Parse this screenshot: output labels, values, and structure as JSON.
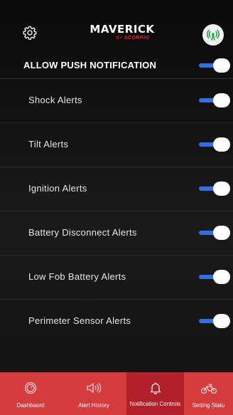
{
  "header": {
    "logo_main": "MAVERICK",
    "logo_by": "BY",
    "logo_brand": "SCORPIO",
    "settings_icon": "gear-icon",
    "signal_icon": "signal-tower-icon"
  },
  "master": {
    "label": "ALLOW PUSH NOTIFICATION",
    "enabled": true
  },
  "alerts": [
    {
      "label": "Shock Alerts",
      "enabled": true
    },
    {
      "label": "Tilt Alerts",
      "enabled": true
    },
    {
      "label": "Ignition Alerts",
      "enabled": true
    },
    {
      "label": "Battery Disconnect Alerts",
      "enabled": true
    },
    {
      "label": "Low Fob Battery Alerts",
      "enabled": true
    },
    {
      "label": "Perimeter Sensor Alerts",
      "enabled": true
    }
  ],
  "tabbar": {
    "tabs": [
      {
        "label": "Dashbaord",
        "icon": "speedometer-icon",
        "active": false
      },
      {
        "label": "Alert History",
        "icon": "speaker-icon",
        "active": false
      },
      {
        "label": "Notification Controls",
        "icon": "bell-icon",
        "active": true
      },
      {
        "label": "Setting Statu",
        "icon": "motorcycle-icon",
        "active": false
      }
    ]
  },
  "colors": {
    "toggle_on": "#2f6fe8",
    "tabbar": "#d63b3d",
    "tab_active": "#b3202a",
    "brand_red": "#d9232d",
    "signal_green": "#1fa33a"
  }
}
